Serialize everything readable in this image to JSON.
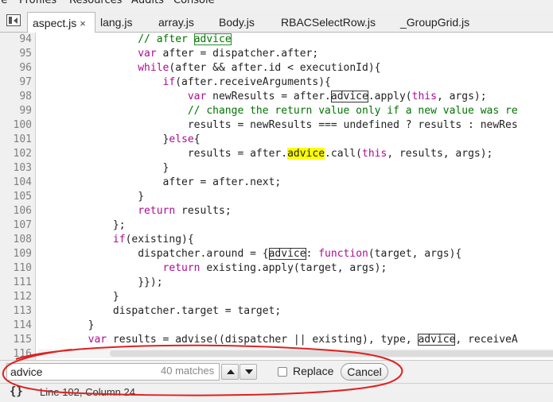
{
  "menubar": {
    "items": [
      "ile",
      "Profiles",
      "Resources",
      "Audits",
      "Console"
    ]
  },
  "tabs": [
    {
      "label": "aspect.js",
      "active": true,
      "close": "×"
    },
    {
      "label": "lang.js"
    },
    {
      "label": "array.js"
    },
    {
      "label": "Body.js"
    },
    {
      "label": "RBACSelectRow.js"
    },
    {
      "label": "_GroupGrid.js"
    }
  ],
  "editor": {
    "lines": [
      {
        "num": "94"
      },
      {
        "num": "95"
      },
      {
        "num": "96"
      },
      {
        "num": "97"
      },
      {
        "num": "98"
      },
      {
        "num": "99"
      },
      {
        "num": "100"
      },
      {
        "num": "101"
      },
      {
        "num": "102"
      },
      {
        "num": "103"
      },
      {
        "num": "104"
      },
      {
        "num": "105"
      },
      {
        "num": "106"
      },
      {
        "num": "107"
      },
      {
        "num": "108"
      },
      {
        "num": "109"
      },
      {
        "num": "110"
      },
      {
        "num": "111"
      },
      {
        "num": "112"
      },
      {
        "num": "113"
      },
      {
        "num": "114"
      },
      {
        "num": "115"
      },
      {
        "num": "116"
      }
    ],
    "tokens": {
      "l94_comment": "// after ",
      "l94_match": "advice",
      "l95_var": "var",
      "l95_rest": " after = dispatcher.after;",
      "l96_kw": "while",
      "l96_rest": "(after && after.id < executionId){",
      "l97_kw": "if",
      "l97_rest": "(after.receiveArguments){",
      "l98_var": "var",
      "l98_a": " newResults = after.",
      "l98_match": "advice",
      "l98_b": ".apply(",
      "l98_this": "this",
      "l98_c": ", args);",
      "l99_comment": "// change the return value only if a new value was re",
      "l100_text": "results = newResults === undefined ? results : newRes",
      "l101_a": "}",
      "l101_kw": "else",
      "l101_b": "{",
      "l102_a": "results = after.",
      "l102_match": "advice",
      "l102_b": ".call(",
      "l102_this": "this",
      "l102_c": ", results, args);",
      "l103_text": "}",
      "l104_text": "after = after.next;",
      "l105_text": "}",
      "l106_kw": "return",
      "l106_rest": " results;",
      "l107_text": "};",
      "l108_kw": "if",
      "l108_rest": "(existing){",
      "l109_a": "dispatcher.around = {",
      "l109_match": "advice",
      "l109_b": ": ",
      "l109_kw": "function",
      "l109_c": "(target, args){",
      "l110_kw": "return",
      "l110_rest": " existing.apply(target, args);",
      "l111_text": "}});",
      "l112_text": "}",
      "l113_text": "dispatcher.target = target;",
      "l114_text": "}",
      "l115_var": "var",
      "l115_a": " results = advise((dispatcher || existing), type, ",
      "l115_match": "advice",
      "l115_b": ", receiveA"
    }
  },
  "search": {
    "query": "advice",
    "match_count": "40 matches",
    "replace_label": "Replace",
    "replace_checked": false,
    "cancel_label": "Cancel"
  },
  "status": {
    "icon": "curly-braces-icon",
    "braces_glyph": "{}",
    "position": "Line 102, Column 24"
  },
  "colors": {
    "keyword": "#aa0d91",
    "comment": "#007400",
    "current_match_highlight": "#ffff00",
    "annotation_ellipse": "#e02020"
  }
}
